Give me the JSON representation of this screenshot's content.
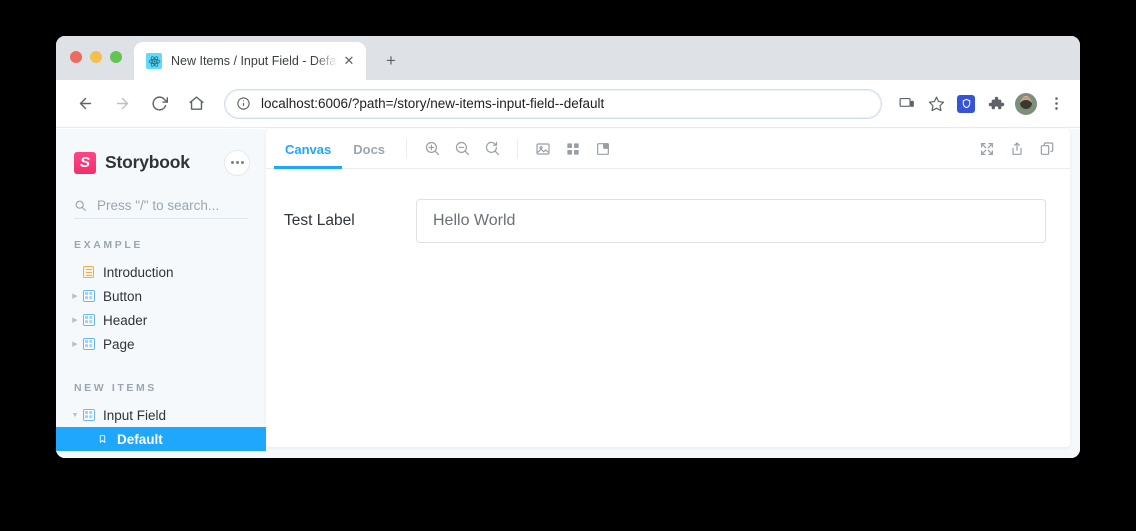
{
  "browser": {
    "tab": {
      "title": "New Items / Input Field - Defau",
      "favicon": "react-icon",
      "close_label": "✕"
    },
    "new_tab_label": "+",
    "nav": {
      "back": "←",
      "forward": "→",
      "reload": "↻",
      "home": "⌂"
    },
    "omnibox": {
      "url": "localhost:6006/?path=/story/new-items-input-field--default",
      "info_icon": "info-circle-icon"
    },
    "actions": {
      "cast": "cast-icon",
      "bookmark": "star-icon",
      "extension_shield": "shield-extension-icon",
      "extensions": "puzzle-piece-icon",
      "profile": "avatar",
      "menu": "kebab-menu-icon"
    }
  },
  "storybook": {
    "brand": {
      "logo_letter": "S",
      "name": "Storybook",
      "menu_button": "more-options"
    },
    "search": {
      "placeholder": "Press \"/\" to search...",
      "icon": "search-icon"
    },
    "sections": [
      {
        "title": "EXAMPLE",
        "items": [
          {
            "label": "Introduction",
            "icon": "document-icon",
            "chevron": "",
            "expandable": false,
            "selected": false,
            "level": 0
          },
          {
            "label": "Button",
            "icon": "component-icon",
            "chevron": "▶",
            "expandable": true,
            "selected": false,
            "level": 0
          },
          {
            "label": "Header",
            "icon": "component-icon",
            "chevron": "▶",
            "expandable": true,
            "selected": false,
            "level": 0
          },
          {
            "label": "Page",
            "icon": "component-icon",
            "chevron": "▶",
            "expandable": true,
            "selected": false,
            "level": 0
          }
        ]
      },
      {
        "title": "NEW ITEMS",
        "items": [
          {
            "label": "Input Field",
            "icon": "component-icon",
            "chevron": "▼",
            "expandable": true,
            "selected": false,
            "level": 0
          },
          {
            "label": "Default",
            "icon": "story-bookmark-icon",
            "chevron": "",
            "expandable": false,
            "selected": true,
            "level": 1
          }
        ]
      }
    ],
    "toolbar": {
      "tabs": [
        {
          "label": "Canvas",
          "active": true
        },
        {
          "label": "Docs",
          "active": false
        }
      ],
      "left_tools": [
        {
          "name": "zoom-in-icon"
        },
        {
          "name": "zoom-out-icon"
        },
        {
          "name": "zoom-reset-icon"
        }
      ],
      "addon_tools": [
        {
          "name": "backgrounds-icon"
        },
        {
          "name": "grid-icon"
        },
        {
          "name": "measure-icon"
        }
      ],
      "right_tools": [
        {
          "name": "fullscreen-icon"
        },
        {
          "name": "open-in-new-tab-icon"
        },
        {
          "name": "copy-canvas-link-icon"
        }
      ]
    },
    "story": {
      "label": "Test Label",
      "input_value": "Hello World",
      "input_placeholder": "Hello World"
    }
  },
  "colors": {
    "accent_blue": "#1ea7fd",
    "brand_pink": "#ff4785",
    "sidebar_bg": "#f6f9fc",
    "text_dark": "#2e3438",
    "text_muted": "#9aa6b0"
  }
}
